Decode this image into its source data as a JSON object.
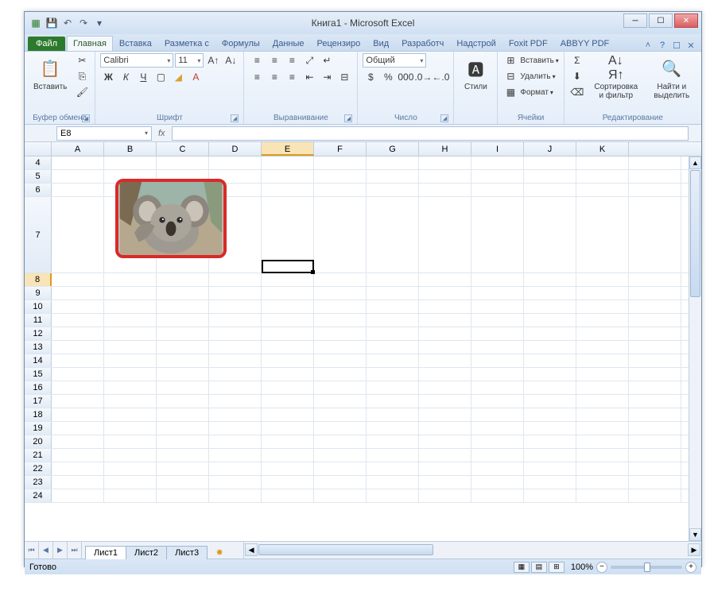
{
  "window": {
    "title": "Книга1 - Microsoft Excel"
  },
  "qat": {
    "save": "💾",
    "undo": "↶",
    "redo": "↷",
    "more": "▾"
  },
  "tabs": {
    "file": "Файл",
    "items": [
      "Главная",
      "Вставка",
      "Разметка с",
      "Формулы",
      "Данные",
      "Рецензиро",
      "Вид",
      "Разработч",
      "Надстрой",
      "Foxit PDF",
      "ABBYY PDF"
    ],
    "active": 0
  },
  "ribbon": {
    "clipboard": {
      "paste": "Вставить",
      "label": "Буфер обмена"
    },
    "font": {
      "name": "Calibri",
      "size": "11",
      "bold": "Ж",
      "italic": "К",
      "underline": "Ч",
      "label": "Шрифт"
    },
    "alignment": {
      "label": "Выравнивание"
    },
    "number": {
      "format": "Общий",
      "label": "Число"
    },
    "styles": {
      "btn": "Стили",
      "label": ""
    },
    "cells": {
      "insert": "Вставить",
      "delete": "Удалить",
      "format": "Формат",
      "label": "Ячейки"
    },
    "editing": {
      "sort": "Сортировка и фильтр",
      "find": "Найти и выделить",
      "label": "Редактирование"
    }
  },
  "formula": {
    "namebox": "E8",
    "fx": "fx"
  },
  "grid": {
    "cols": [
      "A",
      "B",
      "C",
      "D",
      "E",
      "F",
      "G",
      "H",
      "I",
      "J",
      "K"
    ],
    "rows_top": [
      "4",
      "5",
      "6"
    ],
    "row_image": "7",
    "rows_bottom": [
      "8",
      "9",
      "10",
      "11",
      "12",
      "13",
      "14",
      "15",
      "16",
      "17",
      "18",
      "19",
      "20",
      "21",
      "22",
      "23",
      "24"
    ],
    "selected_col": "E",
    "selected_row": "8"
  },
  "sheets": {
    "tabs": [
      "Лист1",
      "Лист2",
      "Лист3"
    ],
    "active": 0
  },
  "status": {
    "ready": "Готово",
    "zoom": "100%"
  },
  "image": {
    "alt": "koala-photo"
  }
}
